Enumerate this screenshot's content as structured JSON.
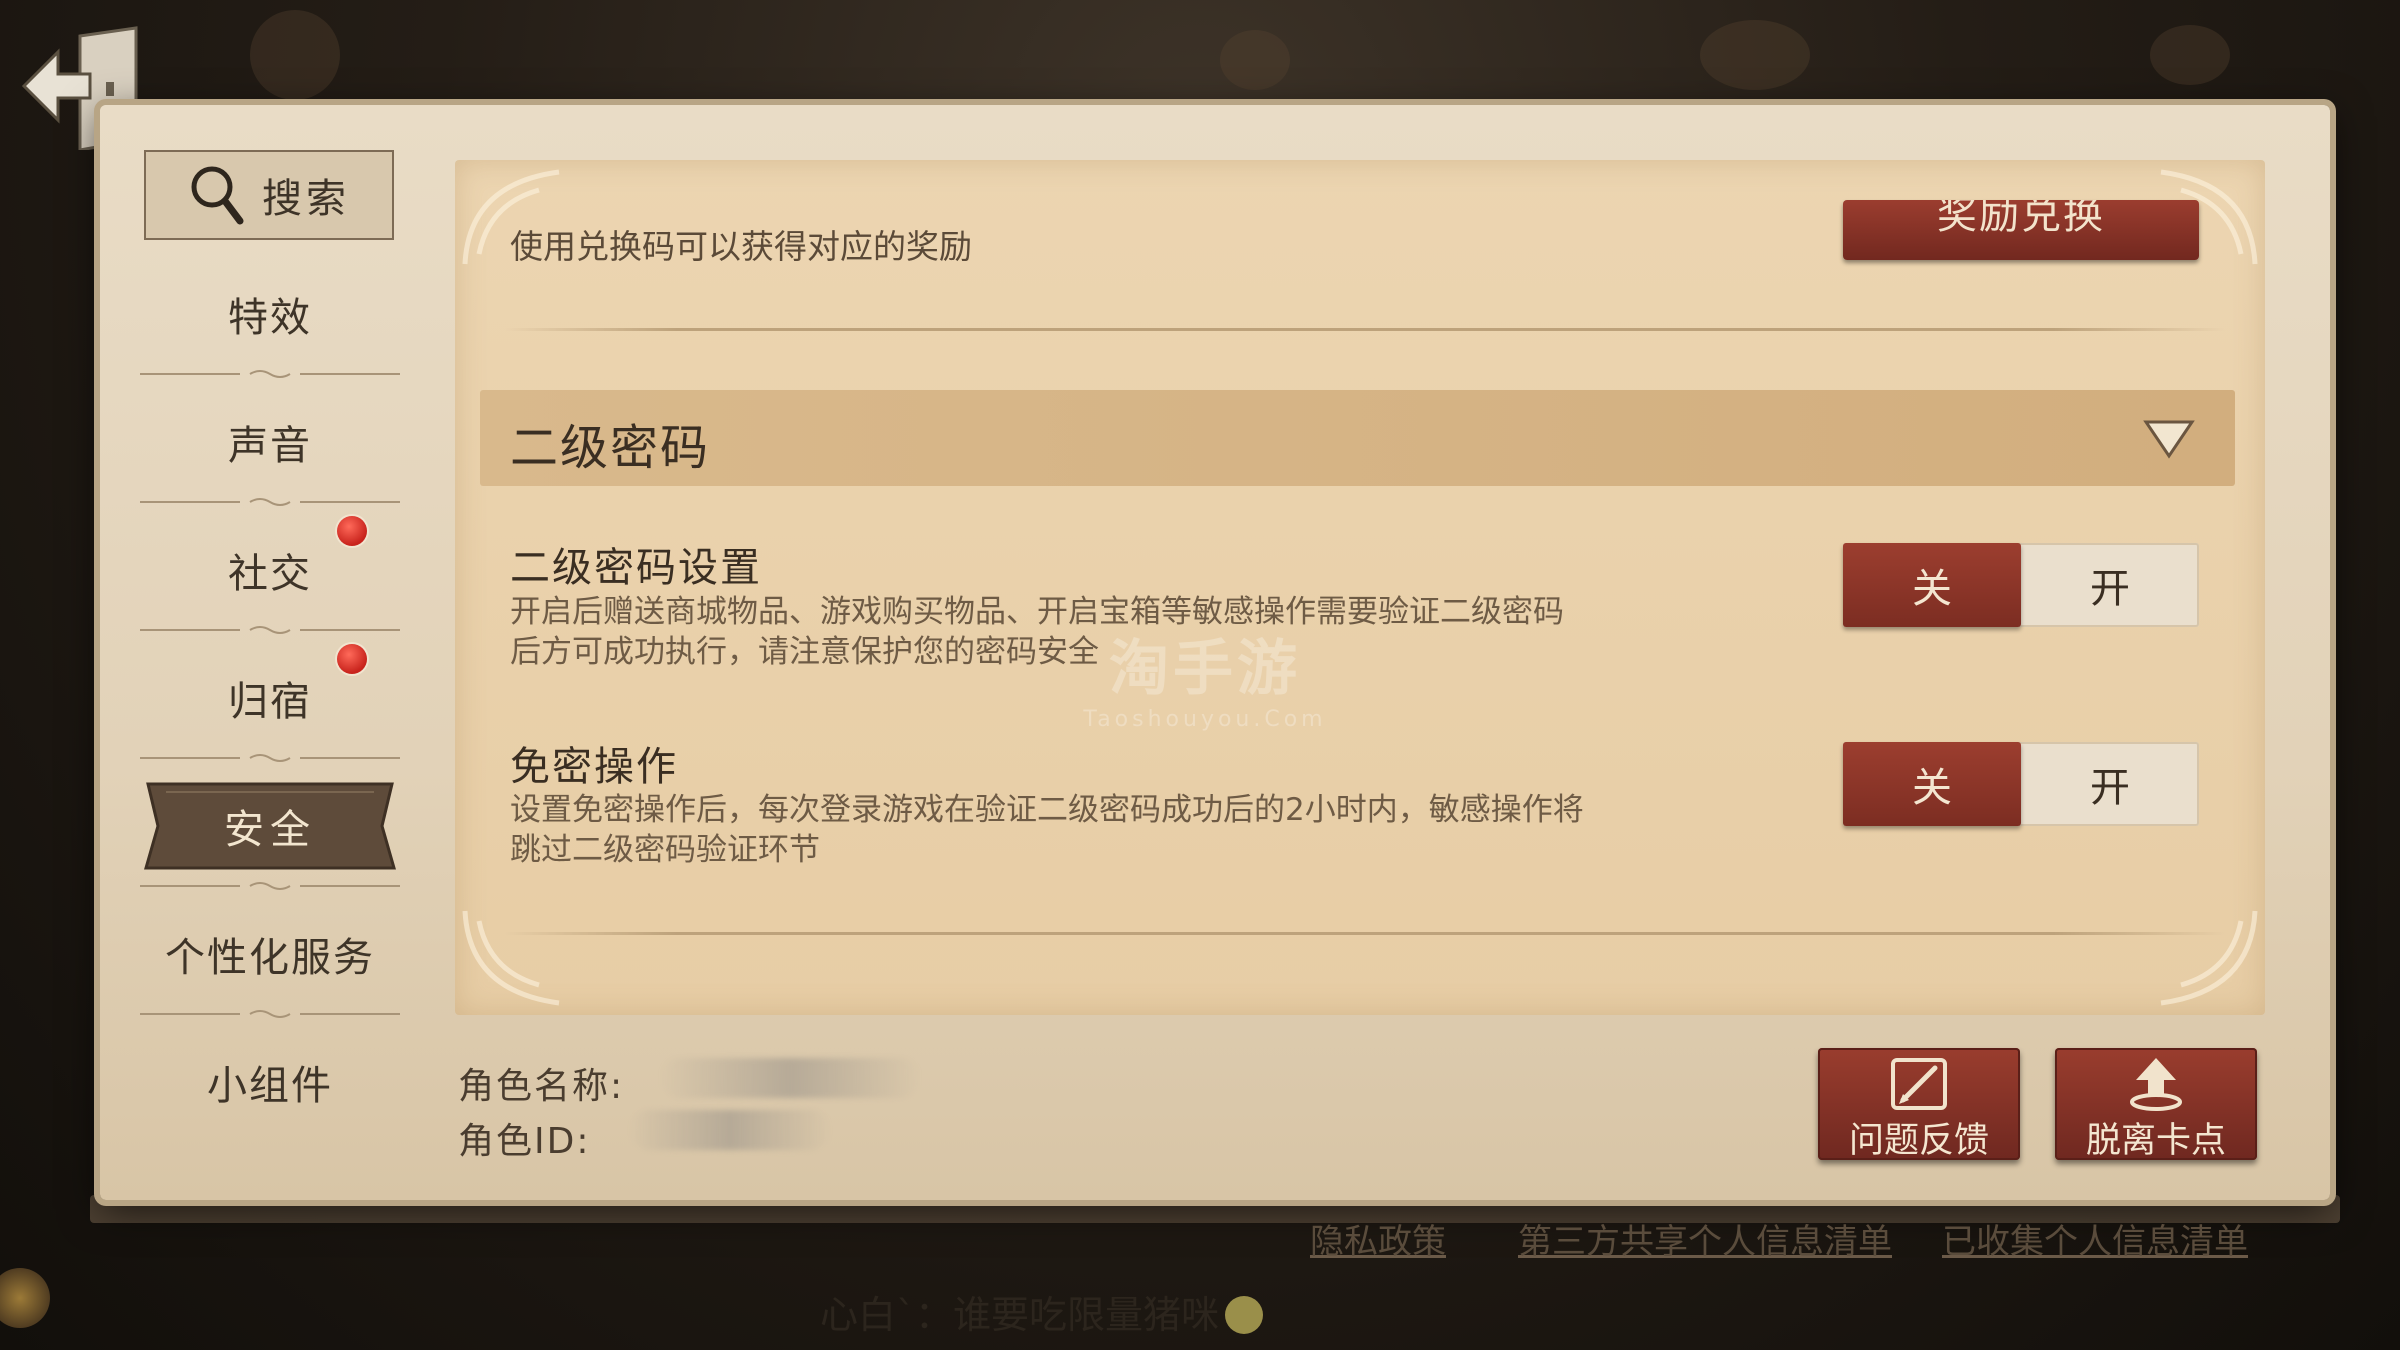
{
  "search": {
    "label": "搜索"
  },
  "sidebar": {
    "items": [
      {
        "label": "特效",
        "badge": false,
        "active": false
      },
      {
        "label": "声音",
        "badge": false,
        "active": false
      },
      {
        "label": "社交",
        "badge": true,
        "active": false
      },
      {
        "label": "归宿",
        "badge": true,
        "active": false
      },
      {
        "label": "安全",
        "badge": false,
        "active": true
      },
      {
        "label": "个性化服务",
        "badge": false,
        "active": false
      },
      {
        "label": "小组件",
        "badge": false,
        "active": false
      }
    ]
  },
  "redeem": {
    "description": "使用兑换码可以获得对应的奖励",
    "button_label": "奖励兑换"
  },
  "section": {
    "title": "二级密码",
    "expanded_icon": "chevron-down-icon"
  },
  "settings": [
    {
      "title": "二级密码设置",
      "description": "开启后赠送商城物品、游戏购买物品、开启宝箱等敏感操作需要验证二级密码后方可成功执行，请注意保护您的密码安全",
      "off_label": "关",
      "on_label": "开",
      "state": "off"
    },
    {
      "title": "免密操作",
      "description": "设置免密操作后，每次登录游戏在验证二级密码成功后的2小时内，敏感操作将跳过二级密码验证环节",
      "off_label": "关",
      "on_label": "开",
      "state": "off"
    }
  ],
  "role": {
    "name_label": "角色名称:",
    "id_label": "角色ID:"
  },
  "actions": {
    "feedback_label": "问题反馈",
    "unstuck_label": "脱离卡点"
  },
  "footer": {
    "privacy_label": "隐私政策",
    "third_party_label": "第三方共享个人信息清单",
    "collected_label": "已收集个人信息清单"
  },
  "chat": {
    "text": "心白`：谁要吃限量猪咪"
  },
  "watermark": {
    "main": "淘手游",
    "sub": "Taoshouyou.Com"
  },
  "colors": {
    "accent_red": "#8a3326",
    "parchment": "#e7cda5",
    "badge_red": "#d9302a"
  }
}
